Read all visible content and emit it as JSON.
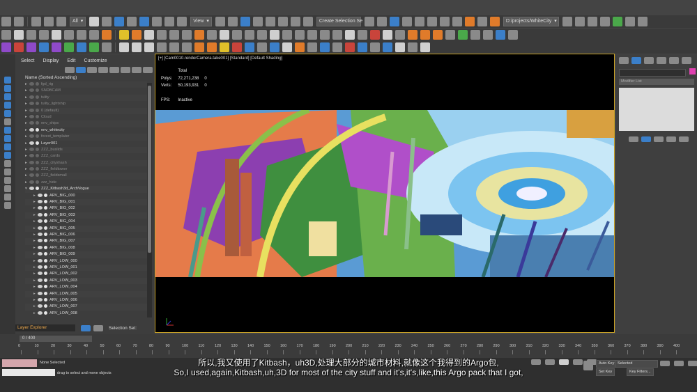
{
  "toolbar": {
    "filter_value": "All",
    "view_value": "View",
    "selection_set_placeholder": "Create Selection Se",
    "project_path": "D:/projects/WhiteCity"
  },
  "explorer": {
    "menu": [
      "Select",
      "Display",
      "Edit",
      "Customize"
    ],
    "column_header": "Name (Sorted Ascending)",
    "rows": [
      {
        "label": "fgd_rig",
        "dim": true,
        "expanded": false,
        "level": 0
      },
      {
        "label": "SNDBCAM",
        "dim": true,
        "expanded": false,
        "level": 0
      },
      {
        "label": "tulity",
        "dim": true,
        "expanded": false,
        "level": 0
      },
      {
        "label": "tulity_lightship",
        "dim": true,
        "expanded": false,
        "level": 0
      },
      {
        "label": "0 (default)",
        "dim": true,
        "expanded": false,
        "level": 0
      },
      {
        "label": "Cloud",
        "dim": true,
        "expanded": false,
        "level": 0
      },
      {
        "label": "env_ships",
        "dim": true,
        "expanded": false,
        "level": 0
      },
      {
        "label": "env_whitecity",
        "dim": false,
        "expanded": false,
        "level": 0
      },
      {
        "label": "forest_templater",
        "dim": true,
        "expanded": false,
        "level": 0
      },
      {
        "label": "Layer001",
        "dim": false,
        "expanded": false,
        "level": 0
      },
      {
        "label": "ZZZ_buslids",
        "dim": true,
        "expanded": false,
        "level": 0
      },
      {
        "label": "ZZZ_cards",
        "dim": true,
        "expanded": false,
        "level": 0
      },
      {
        "label": "ZZZ_cityshash",
        "dim": true,
        "expanded": false,
        "level": 0
      },
      {
        "label": "ZZZ_fieldtower",
        "dim": true,
        "expanded": false,
        "level": 0
      },
      {
        "label": "ZZZ_fieldsmall",
        "dim": true,
        "expanded": false,
        "level": 0
      },
      {
        "label": "zzz_hide",
        "dim": true,
        "expanded": false,
        "level": 0
      },
      {
        "label": "ZZZ_Kitbash3d_ArchVogue",
        "dim": false,
        "expanded": true,
        "level": 0
      },
      {
        "label": "ARV_BIG_000",
        "dim": false,
        "expanded": false,
        "level": 1
      },
      {
        "label": "ARV_BIG_001",
        "dim": false,
        "expanded": false,
        "level": 1
      },
      {
        "label": "ARV_BIG_002",
        "dim": false,
        "expanded": false,
        "level": 1
      },
      {
        "label": "ARV_BIG_003",
        "dim": false,
        "expanded": false,
        "level": 1
      },
      {
        "label": "ARV_BIG_004",
        "dim": false,
        "expanded": false,
        "level": 1
      },
      {
        "label": "ARV_BIG_005",
        "dim": false,
        "expanded": false,
        "level": 1
      },
      {
        "label": "ARV_BIG_006",
        "dim": false,
        "expanded": false,
        "level": 1
      },
      {
        "label": "ARV_BIG_007",
        "dim": false,
        "expanded": false,
        "level": 1
      },
      {
        "label": "ARV_BIG_008",
        "dim": false,
        "expanded": false,
        "level": 1
      },
      {
        "label": "ARV_BIG_009",
        "dim": false,
        "expanded": false,
        "level": 1
      },
      {
        "label": "ARV_LOW_000",
        "dim": false,
        "expanded": false,
        "level": 1
      },
      {
        "label": "ARV_LOW_001",
        "dim": false,
        "expanded": false,
        "level": 1
      },
      {
        "label": "ARV_LOW_002",
        "dim": false,
        "expanded": false,
        "level": 1
      },
      {
        "label": "ARV_LOW_003",
        "dim": false,
        "expanded": false,
        "level": 1
      },
      {
        "label": "ARV_LOW_004",
        "dim": false,
        "expanded": false,
        "level": 1
      },
      {
        "label": "ARV_LOW_005",
        "dim": false,
        "expanded": false,
        "level": 1
      },
      {
        "label": "ARV_LOW_006",
        "dim": false,
        "expanded": false,
        "level": 1
      },
      {
        "label": "ARV_LOW_007",
        "dim": false,
        "expanded": false,
        "level": 1
      },
      {
        "label": "ARV_LOW_008",
        "dim": false,
        "expanded": false,
        "level": 1
      }
    ],
    "layer_explorer_label": "Layer Explorer",
    "selection_set_label": "Selection Set:"
  },
  "viewport": {
    "label": "[+] [Cam0010.renderCamera.take001] [Standard] [Default Shading]",
    "stats_total": "Total",
    "polys_label": "Polys:",
    "polys_value": "72,271,238",
    "polys_sel": "0",
    "verts_label": "Verts:",
    "verts_value": "50,193,931",
    "verts_sel": "0",
    "fps_label": "FPS:",
    "fps_value": "Inactive"
  },
  "right_panel": {
    "modifier_list": "Modifier List"
  },
  "timeline": {
    "frame_counter": "0 / 400",
    "ticks": [
      "0",
      "10",
      "20",
      "30",
      "40",
      "50",
      "60",
      "70",
      "80",
      "90",
      "100",
      "110",
      "120",
      "130",
      "140",
      "150",
      "160",
      "170",
      "180",
      "190",
      "200",
      "210",
      "220",
      "230",
      "240",
      "250",
      "260",
      "270",
      "280",
      "290",
      "300",
      "310",
      "320",
      "330",
      "340",
      "350",
      "360",
      "370",
      "380",
      "390",
      "400"
    ]
  },
  "status": {
    "selection": "None Selected",
    "prompt": "drag to select and move objects",
    "autokey": "Auto Key",
    "selected": "Selected",
    "setkey": "Set Key",
    "key_filters": "Key Filters..."
  },
  "subtitles": {
    "chinese": "所以,我又使用了Kitbash，uh3D,处理大部分的城市材料,就像这个我得到的Argo包,",
    "english": "So,I used,again,Kitbash,uh,3D for most of the city stuff and it's,it's,like,this Argo pack that I got,"
  },
  "colors": {
    "viewport_border": "#c9a227",
    "accent_blue": "#3b7fc9",
    "panel": "#3d3d3d"
  }
}
